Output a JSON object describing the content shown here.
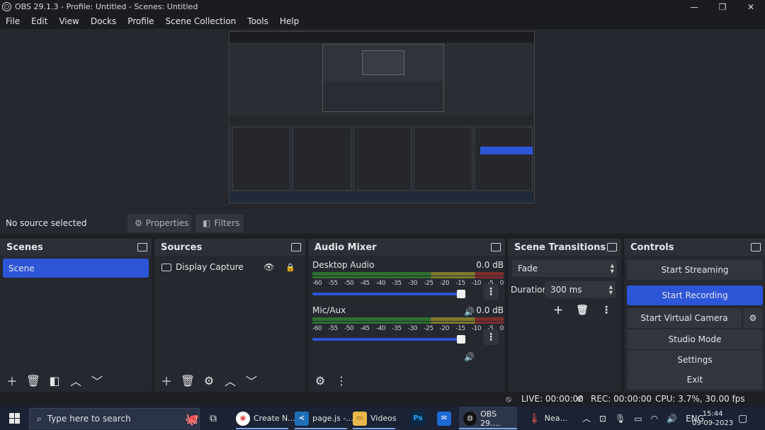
{
  "window": {
    "title": "OBS 29.1.3 - Profile: Untitled - Scenes: Untitled",
    "minimize": "—",
    "restore": "❐",
    "close": "✕"
  },
  "menu": [
    "File",
    "Edit",
    "View",
    "Docks",
    "Profile",
    "Scene Collection",
    "Tools",
    "Help"
  ],
  "source_bar": {
    "status": "No source selected",
    "properties_label": "Properties",
    "filters_label": "Filters"
  },
  "scenes": {
    "title": "Scenes",
    "items": [
      "Scene"
    ]
  },
  "sources": {
    "title": "Sources",
    "items": [
      "Display Capture"
    ]
  },
  "mixer": {
    "title": "Audio Mixer",
    "channels": [
      {
        "name": "Desktop Audio",
        "db": "0.0 dB",
        "volume_fraction": 1.0
      },
      {
        "name": "Mic/Aux",
        "db": "0.0 dB",
        "volume_fraction": 1.0
      }
    ],
    "ticks": [
      "-60",
      "-55",
      "-50",
      "-45",
      "-40",
      "-35",
      "-30",
      "-25",
      "-20",
      "-15",
      "-10",
      "-5",
      "0"
    ]
  },
  "transitions": {
    "title": "Scene Transitions",
    "selected": "Fade",
    "duration_label": "Duration",
    "duration_value": "300 ms"
  },
  "controls": {
    "title": "Controls",
    "start_streaming": "Start Streaming",
    "start_recording": "Start Recording",
    "start_virtual_camera": "Start Virtual Camera",
    "studio_mode": "Studio Mode",
    "settings": "Settings",
    "exit": "Exit"
  },
  "status": {
    "live": "LIVE: 00:00:00",
    "rec": "REC: 00:00:00",
    "cpu": "CPU: 3.7%, 30.00 fps"
  },
  "taskbar": {
    "search_placeholder": "Type here to search",
    "apps": [
      {
        "label": "Create N...",
        "icon": "chrome-icon"
      },
      {
        "label": "page.js -...",
        "icon": "vscode-icon"
      },
      {
        "label": "Videos",
        "icon": "folder-icon"
      },
      {
        "label": "",
        "icon": "photoshop-icon"
      },
      {
        "label": "",
        "icon": "mail-icon"
      },
      {
        "label": "OBS 29....",
        "icon": "obs-icon"
      },
      {
        "label": "Nea...",
        "icon": "weather-icon"
      }
    ],
    "lang": "ENG",
    "time": "15:44",
    "date": "09-09-2023"
  },
  "colors": {
    "accent": "#2d55d8",
    "panel": "#26282f",
    "taskbar": "#1a2233"
  }
}
